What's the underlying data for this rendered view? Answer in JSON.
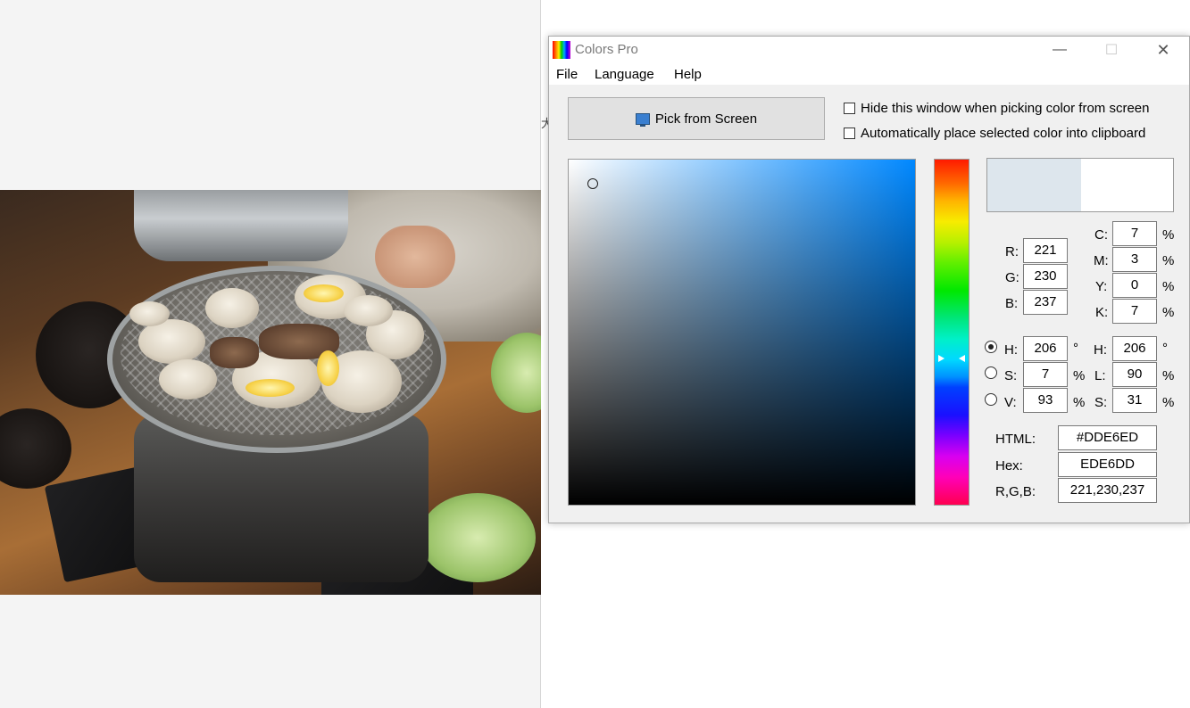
{
  "window": {
    "title": "Colors Pro",
    "min_glyph": "—",
    "max_glyph": "☐",
    "close_glyph": "✕"
  },
  "menu": {
    "file": "File",
    "language": "Language",
    "help": "Help"
  },
  "toolbar": {
    "pick_label": "Pick from Screen"
  },
  "options": {
    "hide_window": {
      "label": "Hide this window when picking color from screen",
      "checked": false
    },
    "auto_clipboard": {
      "label": "Automatically place selected color into clipboard",
      "checked": false
    }
  },
  "colors": {
    "selected": "#dde6ed",
    "spectrum_hue": "#0088ff"
  },
  "icons": {
    "app": "rainbow-app-icon",
    "pick": "monitor-icon"
  },
  "background": {
    "cjk_glyph": "大"
  },
  "rgb": {
    "r_label": "R:",
    "g_label": "G:",
    "b_label": "B:",
    "r": "221",
    "g": "230",
    "b": "237"
  },
  "cmyk": {
    "c_label": "C:",
    "m_label": "M:",
    "y_label": "Y:",
    "k_label": "K:",
    "c": "7",
    "m": "3",
    "y": "0",
    "k": "7",
    "unit": "%"
  },
  "hsv": {
    "h_label": "H:",
    "s_label": "S:",
    "v_label": "V:",
    "h": "206",
    "s": "7",
    "v": "93",
    "h_unit": "°",
    "unit": "%",
    "selected_mode": "H"
  },
  "hsl": {
    "h_label": "H:",
    "l_label": "L:",
    "s_label": "S:",
    "h": "206",
    "l": "90",
    "s": "31",
    "h_unit": "°",
    "unit": "%"
  },
  "codes": {
    "html_label": "HTML:",
    "hex_label": "Hex:",
    "rgb_label": "R,G,B:",
    "html": "#DDE6ED",
    "hex": "EDE6DD",
    "rgb": "221,230,237"
  }
}
